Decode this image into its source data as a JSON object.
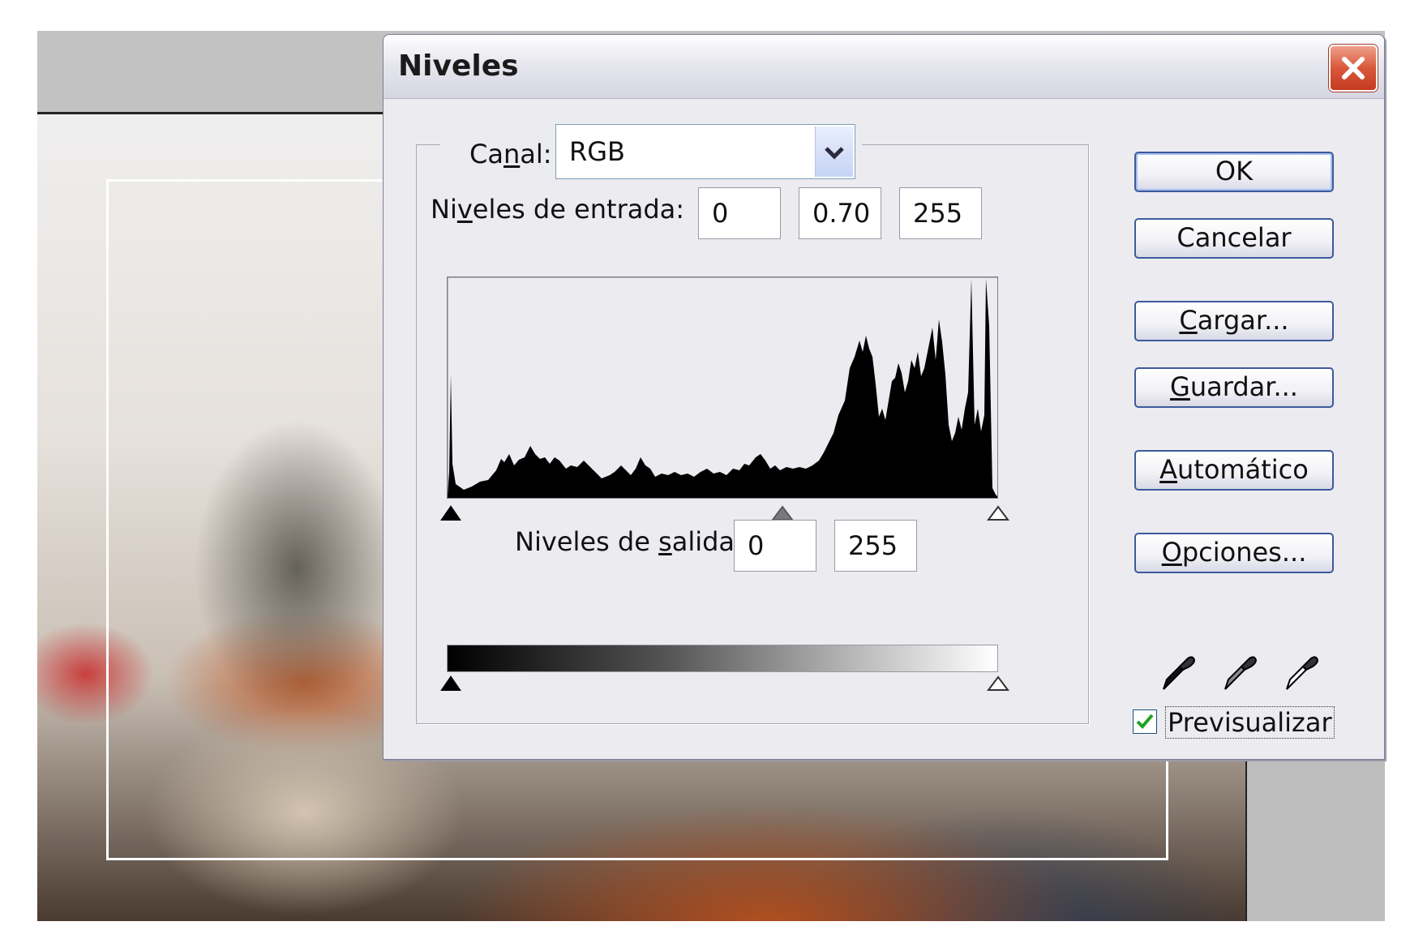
{
  "dialog": {
    "title": "Niveles",
    "channel": {
      "label_pre": "Ca",
      "label_key": "n",
      "label_post": "al:",
      "value": "RGB"
    },
    "input_levels": {
      "label_pre": "Ni",
      "label_key": "v",
      "label_post": "eles de entrada:",
      "black": "0",
      "gamma": "0.70",
      "white": "255"
    },
    "output_levels": {
      "label_pre": "Niveles de ",
      "label_key": "s",
      "label_post": "alida:",
      "black": "0",
      "white": "255"
    },
    "buttons": {
      "ok": "OK",
      "cancel": "Cancelar",
      "load_key": "C",
      "load_rest": "argar...",
      "save_key": "G",
      "save_rest": "uardar...",
      "auto_key": "A",
      "auto_rest": "utomático",
      "options_key": "O",
      "options_rest": "pciones..."
    },
    "preview": {
      "label": "Previsualizar",
      "checked": true
    },
    "eyedroppers": [
      "black-eyedropper-icon",
      "gray-eyedropper-icon",
      "white-eyedropper-icon"
    ],
    "histogram_color": "#000000"
  }
}
